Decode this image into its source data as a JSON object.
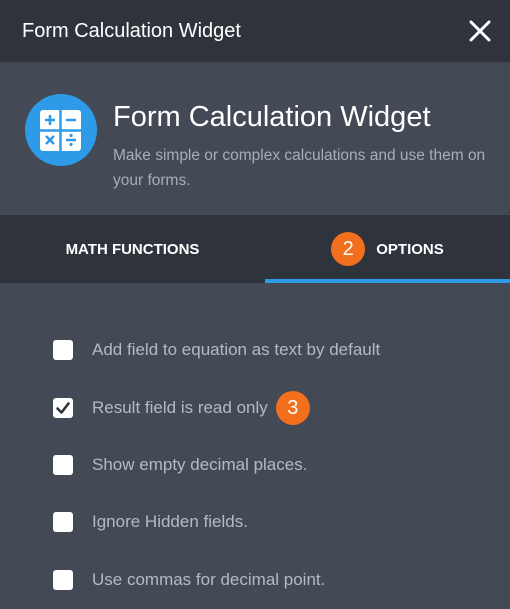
{
  "window": {
    "title": "Form Calculation Widget"
  },
  "widget": {
    "icon": "calculator-icon",
    "title": "Form Calculation Widget",
    "description": "Make simple or complex calculations and use them on your forms."
  },
  "tabs": [
    {
      "label": "MATH FUNCTIONS",
      "active": false
    },
    {
      "label": "OPTIONS",
      "active": true,
      "step_badge": "2"
    }
  ],
  "options": [
    {
      "label": "Add field to equation as text by default",
      "checked": false
    },
    {
      "label": "Result field is read only",
      "checked": true,
      "step_badge": "3"
    },
    {
      "label": "Show empty decimal places.",
      "checked": false
    },
    {
      "label": "Ignore Hidden fields.",
      "checked": false
    },
    {
      "label": "Use commas for decimal point.",
      "checked": false
    }
  ],
  "colors": {
    "accent": "#2d9be8",
    "step_badge": "#f26f1d",
    "titlebar": "#2f333c",
    "panel": "#434955"
  }
}
